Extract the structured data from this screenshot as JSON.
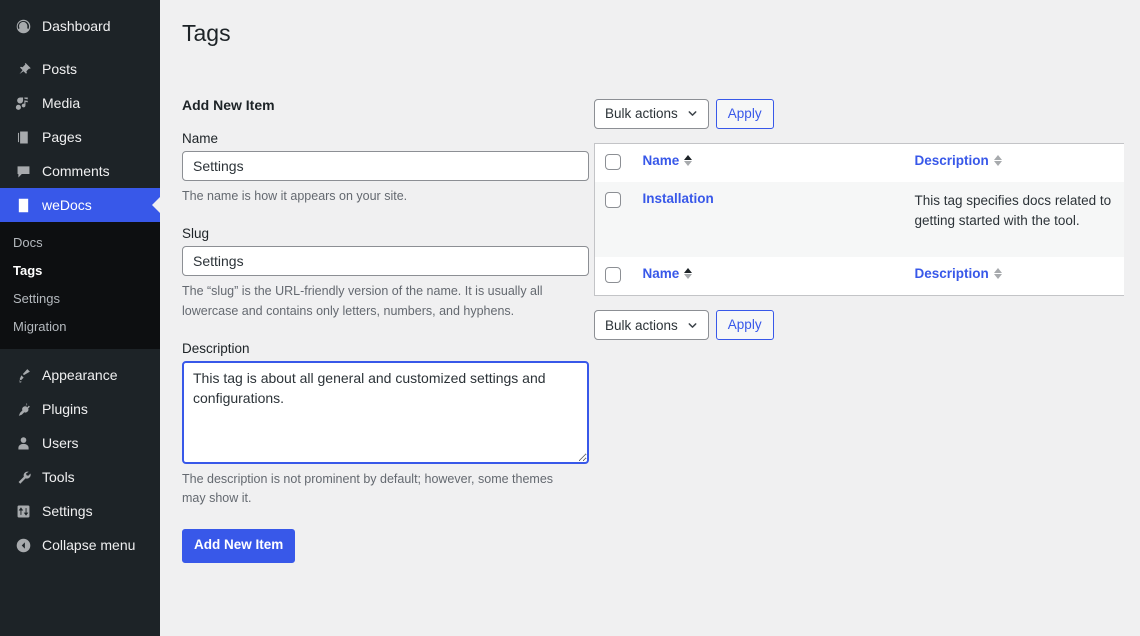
{
  "sidebar": {
    "items": [
      {
        "label": "Dashboard",
        "icon": "dashboard-icon",
        "active": false
      },
      {
        "label": "Posts",
        "icon": "pin-icon",
        "active": false
      },
      {
        "label": "Media",
        "icon": "media-icon",
        "active": false
      },
      {
        "label": "Pages",
        "icon": "pages-icon",
        "active": false
      },
      {
        "label": "Comments",
        "icon": "comments-icon",
        "active": false
      },
      {
        "label": "weDocs",
        "icon": "document-icon",
        "active": true
      },
      {
        "label": "Appearance",
        "icon": "brush-icon",
        "active": false
      },
      {
        "label": "Plugins",
        "icon": "plug-icon",
        "active": false
      },
      {
        "label": "Users",
        "icon": "user-icon",
        "active": false
      },
      {
        "label": "Tools",
        "icon": "wrench-icon",
        "active": false
      },
      {
        "label": "Settings",
        "icon": "sliders-icon",
        "active": false
      },
      {
        "label": "Collapse menu",
        "icon": "collapse-arrow-icon",
        "active": false
      }
    ],
    "submenu": [
      {
        "label": "Docs",
        "current": false
      },
      {
        "label": "Tags",
        "current": true
      },
      {
        "label": "Settings",
        "current": false
      },
      {
        "label": "Migration",
        "current": false
      }
    ]
  },
  "header": {
    "title": "Tags"
  },
  "form": {
    "heading": "Add New Item",
    "name": {
      "label": "Name",
      "value": "Settings",
      "placeholder": "",
      "help": "The name is how it appears on your site."
    },
    "slug": {
      "label": "Slug",
      "value": "Settings",
      "placeholder": "",
      "help": "The “slug” is the URL-friendly version of the name. It is usually all lowercase and contains only letters, numbers, and hyphens."
    },
    "description": {
      "label": "Description",
      "value": "This tag is about all general and customized settings and configurations.",
      "placeholder": "",
      "help": "The description is not prominent by default; however, some themes may show it."
    },
    "submit_label": "Add New Item"
  },
  "bulk": {
    "select_label": "Bulk actions",
    "apply_label": "Apply"
  },
  "table": {
    "columns": [
      {
        "label": "Name",
        "sorted": "asc"
      },
      {
        "label": "Description",
        "sorted": "none"
      }
    ],
    "rows": [
      {
        "name": "Installation",
        "description": "This tag specifies docs related to getting started with the tool."
      }
    ]
  },
  "colors": {
    "accent": "#3858e9",
    "sidebar_bg": "#1d2327",
    "submenu_bg": "#0d0f11",
    "page_bg": "#f0f0f1",
    "row_bg": "#f6f7f7",
    "border": "#c3c4c7",
    "muted_text": "#646970"
  }
}
